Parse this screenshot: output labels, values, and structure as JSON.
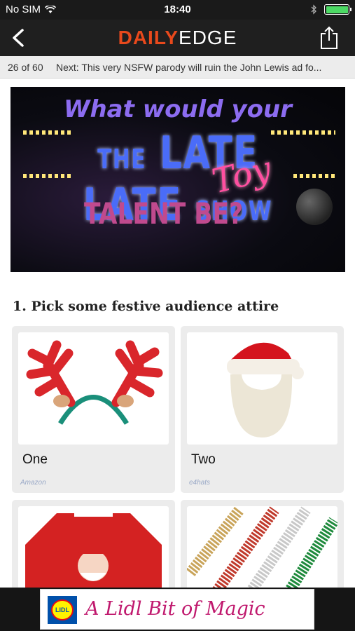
{
  "status": {
    "carrier": "No SIM",
    "time": "18:40",
    "battery_level": 1.0
  },
  "navbar": {
    "logo_bold": "DAILY",
    "logo_light": "EDGE"
  },
  "nextbar": {
    "counter": "26 of 60",
    "next_text": "Next: This very NSFW parody will ruin the John Lewis ad fo..."
  },
  "hero": {
    "line1": "What would your",
    "line2_a": "THE",
    "line2_b": "LATE LATE",
    "line2_c": "SHOW",
    "toy": "Toy",
    "line3": "TALENT BE?"
  },
  "section": {
    "title": "1. Pick some festive audience attire"
  },
  "cards": [
    {
      "label": "One",
      "credit": "Amazon"
    },
    {
      "label": "Two",
      "credit": "e4hats"
    },
    {
      "label": "",
      "credit": ""
    },
    {
      "label": "",
      "credit": ""
    }
  ],
  "ad": {
    "logo_text": "LIDL",
    "tagline": "A Lidl Bit of Magic"
  },
  "colors": {
    "brand_orange": "#e8491c",
    "ad_pink": "#c0196e",
    "battery_green": "#4cd964"
  }
}
